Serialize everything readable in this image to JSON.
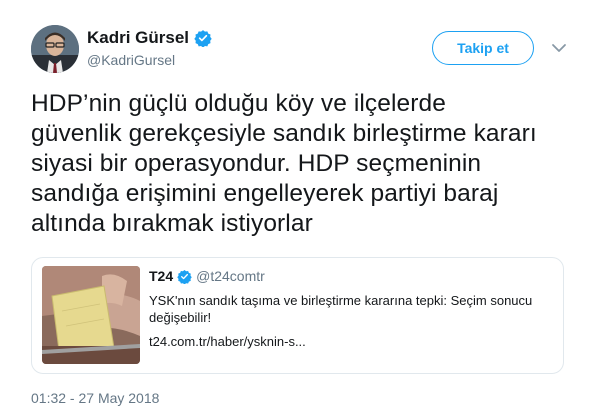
{
  "author": {
    "name": "Kadri Gürsel",
    "handle": "@KadriGursel",
    "verified_icon": "verified-badge-icon"
  },
  "actions": {
    "follow_label": "Takip et",
    "more_icon": "chevron-down-icon"
  },
  "tweet": {
    "line1": "HDP’nin güçlü olduğu köy ve ilçelerde",
    "line2": "güvenlik gerekçesiyle sandık birleştirme kararı",
    "line3": "siyasi bir operasyondur. HDP seçmeninin",
    "line4": "sandığa erişimini engelleyerek partiyi baraj",
    "line5": "altında bırakmak istiyorlar",
    "timestamp": "01:32 - 27 May 2018"
  },
  "quote": {
    "name": "T24",
    "handle": "@t24comtr",
    "text_line1": "YSK'nın sandık taşıma ve birleştirme kararına tepki: Seçim sonucu",
    "text_line2": "değişebilir!",
    "link": "t24.com.tr/haber/ysknin-s..."
  },
  "colors": {
    "accent": "#1da1f2",
    "text": "#14171a",
    "secondary": "#657786",
    "border": "#e1e8ed"
  }
}
